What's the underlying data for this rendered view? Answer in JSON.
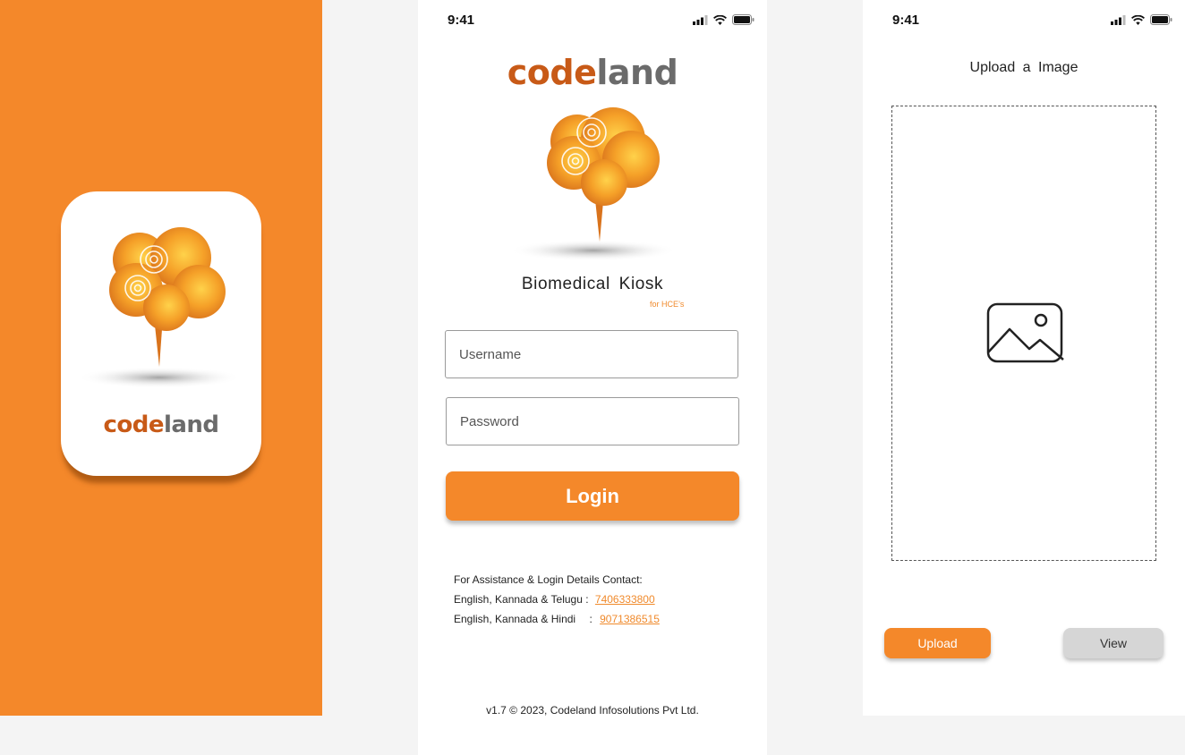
{
  "colors": {
    "brand_orange": "#f4882a",
    "brand_dark_orange": "#c85a17",
    "wordmark_grey": "#6b6b6b"
  },
  "splash": {
    "logo_icon": "codeland-tree-logo",
    "wordmark": {
      "part1": "code",
      "part2": "land"
    }
  },
  "login": {
    "status": {
      "time": "9:41"
    },
    "wordmark": {
      "part1": "code",
      "part2": "land"
    },
    "app_name": "Biomedical  Kiosk",
    "app_subtitle": "for HCE’s",
    "username_placeholder": "Username",
    "password_placeholder": "Password",
    "login_label": "Login",
    "contact": {
      "heading": "For Assistance & Login Details Contact:",
      "line1_label": "English, Kannada & Telugu :",
      "line1_phone": "7406333800",
      "line2_label": "English, Kannada & Hindi",
      "line2_sep": ":",
      "line2_phone": "9071386515"
    },
    "footer": "v1.7 © 2023, Codeland Infosolutions Pvt Ltd."
  },
  "upload": {
    "status": {
      "time": "9:41"
    },
    "title": "Upload  a  Image",
    "placeholder_icon": "image-icon",
    "upload_label": "Upload",
    "view_label": "View"
  }
}
